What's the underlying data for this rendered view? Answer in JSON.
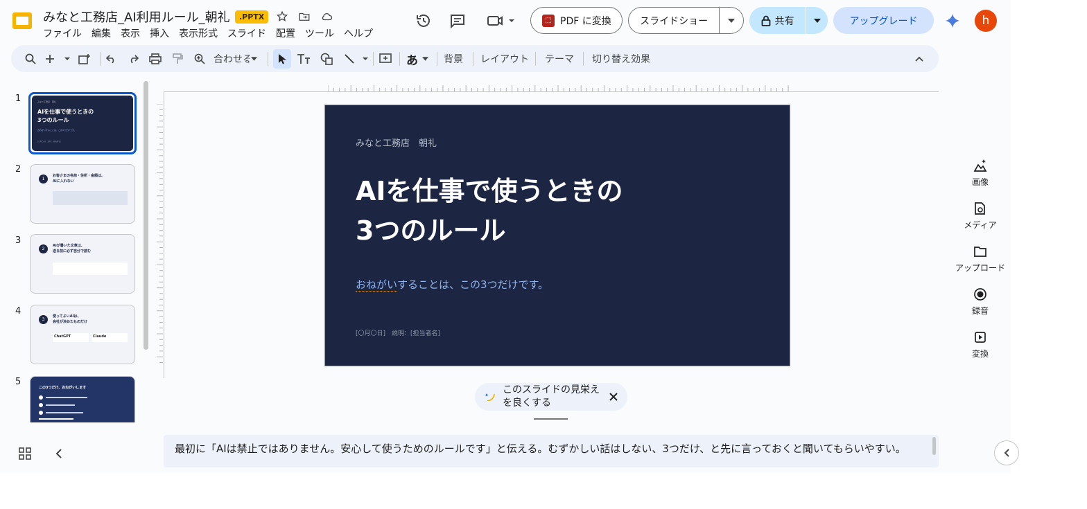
{
  "document": {
    "title": "みなと工務店_AI利用ルール_朝礼",
    "format_badge": ".PPTX"
  },
  "menu": [
    "ファイル",
    "編集",
    "表示",
    "挿入",
    "表示形式",
    "スライド",
    "配置",
    "ツール",
    "ヘルプ"
  ],
  "header_buttons": {
    "pdf": "PDF に変換",
    "slideshow": "スライドショー",
    "share": "共有",
    "upgrade": "アップグレード",
    "avatar_initial": "h"
  },
  "toolbar": {
    "zoom_label": "合わせる",
    "font_label": "あ",
    "background": "背景",
    "layout": "レイアウト",
    "theme": "テーマ",
    "transition": "切り替え効果"
  },
  "slides": [
    {
      "number": "1",
      "kicker": "みなと工務店　朝礼",
      "title": "AIを仕事で使うときの\n3つのルール",
      "subtitle": "おねがいすることは、この3つだけです。",
      "footer": "[〇月〇日]　説明：[担当者名]"
    },
    {
      "number": "2",
      "badge": "1",
      "title": "お客さまの名前・住所・金額は、\nAIに入れない"
    },
    {
      "number": "3",
      "badge": "2",
      "title": "AIが書いた文章は、\n送る前に必ず自分で読む"
    },
    {
      "number": "4",
      "badge": "3",
      "title": "使ってよいAIは、\n会社が決めたものだけ",
      "card1": "ChatGPT",
      "card2": "Claude"
    },
    {
      "number": "5",
      "title": "この3つだけ、おねがいします"
    }
  ],
  "current_slide": {
    "kicker": "みなと工務店　朝礼",
    "title_line1": "AIを仕事で使うときの",
    "title_line2": "3つのルール",
    "subtitle_underlined": "おねがい",
    "subtitle_rest": "することは、この3つだけです。",
    "footer": "[〇月〇日]　説明：[担当者名]"
  },
  "suggestion": {
    "line1": "このスライドの見栄え",
    "line2": "を良くする"
  },
  "notes": "最初に「AIは禁止ではありません。安心して使うためのルールです」と伝える。むずかしい話はしない、3つだけ、と先に言っておくと聞いてもらいやすい。",
  "side_panel": [
    {
      "label": "画像",
      "icon": "image-sparkle-icon"
    },
    {
      "label": "メディア",
      "icon": "media-icon"
    },
    {
      "label": "アップロード",
      "icon": "folder-icon"
    },
    {
      "label": "録音",
      "icon": "record-icon"
    },
    {
      "label": "変換",
      "icon": "convert-icon"
    }
  ],
  "colors": {
    "slide_bg": "#1c2541",
    "accent": "#0b57d0",
    "badge": "#fbbc04",
    "avatar": "#e8470a"
  }
}
